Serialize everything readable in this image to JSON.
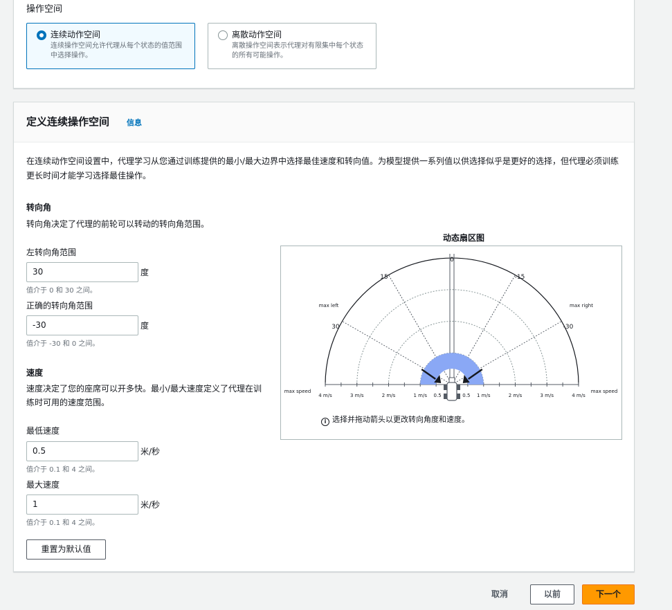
{
  "action_space": {
    "label": "操作空间",
    "options": [
      {
        "title": "连续动作空间",
        "desc": "连续操作空间允许代理从每个状态的值范围中选择操作。",
        "selected": true
      },
      {
        "title": "离散动作空间",
        "desc": "离散操作空间表示代理对有限集中每个状态的所有可能操作。",
        "selected": false
      }
    ]
  },
  "define": {
    "title": "定义连续操作空间",
    "info_link": "信息",
    "intro": "在连续动作空间设置中，代理学习从您通过训练提供的最小/最大边界中选择最佳速度和转向值。为模型提供一系列值以供选择似乎是更好的选择，但代理必须训练更长时间才能学习选择最佳操作。"
  },
  "steering": {
    "heading": "转向角",
    "desc": "转向角决定了代理的前轮可以转动的转向角范围。",
    "left_label": "左转向角范围",
    "left_value": "30",
    "left_unit": "度",
    "left_hint": "值介于 0 和 30 之间。",
    "right_label": "正确的转向角范围",
    "right_value": "-30",
    "right_unit": "度",
    "right_hint": "值介于 -30 和 0 之间。"
  },
  "speed": {
    "heading": "速度",
    "desc": "速度决定了您的座席可以开多快。最小/最大速度定义了代理在训练时可用的速度范围。",
    "min_label": "最低速度",
    "min_value": "0.5",
    "min_unit": "米/秒",
    "min_hint": "值介于 0.1 和 4 之间。",
    "max_label": "最大速度",
    "max_value": "1",
    "max_unit": "米/秒",
    "max_hint": "值介于 0.1 和 4 之间。"
  },
  "reset_button": "重置为默认值",
  "sector": {
    "title": "动态扇区图",
    "angle_labels": {
      "top": "0",
      "left15": "15",
      "right15": "-15",
      "left30": "30",
      "right30": "-30"
    },
    "side_labels": {
      "max_left": "max left",
      "max_right": "max right",
      "max_speed": "max speed"
    },
    "speed_ticks_left": [
      "4 m/s",
      "3 m/s",
      "2 m/s",
      "1 m/s",
      "0.5"
    ],
    "speed_ticks_right": [
      "0.5",
      "1 m/s",
      "2 m/s",
      "3 m/s",
      "4 m/s"
    ],
    "note": "选择并拖动箭头以更改转向角度和速度。",
    "steering_left_deg": 30,
    "steering_right_deg": -30,
    "speed_min": 0.5,
    "speed_max": 1,
    "speed_axis_max": 4,
    "fill_color": "#8aa8f5"
  },
  "footer": {
    "cancel": "取消",
    "previous": "以前",
    "next": "下一个"
  }
}
